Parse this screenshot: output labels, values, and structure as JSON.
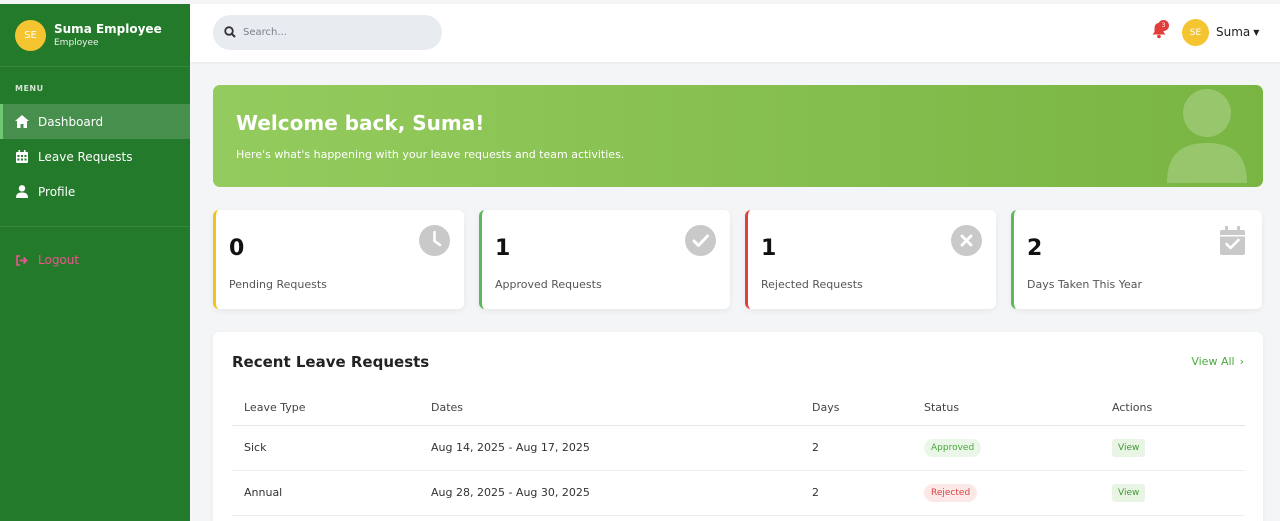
{
  "sidebar": {
    "user_initials": "SE",
    "user_name": "Suma Employee",
    "user_role": "Employee",
    "menu_heading": "MENU",
    "items": [
      {
        "label": "Dashboard",
        "icon": "home-icon",
        "active": true
      },
      {
        "label": "Leave Requests",
        "icon": "calendar-icon",
        "active": false
      },
      {
        "label": "Profile",
        "icon": "user-icon",
        "active": false
      }
    ],
    "logout_label": "Logout"
  },
  "topbar": {
    "search_placeholder": "Search...",
    "notification_count": "3",
    "user_initials": "SE",
    "user_name": "Suma"
  },
  "welcome": {
    "title": "Welcome back, Suma!",
    "subtitle": "Here's what's happening with your leave requests and team activities."
  },
  "stats": [
    {
      "value": "0",
      "label": "Pending Requests",
      "color": "#f2c31b",
      "icon": "clock-icon"
    },
    {
      "value": "1",
      "label": "Approved Requests",
      "color": "#5cb85c",
      "icon": "check-circle-icon"
    },
    {
      "value": "1",
      "label": "Rejected Requests",
      "color": "#e0413f",
      "icon": "x-circle-icon"
    },
    {
      "value": "2",
      "label": "Days Taken This Year",
      "color": "#5cb85c",
      "icon": "calendar-check-icon"
    }
  ],
  "recent": {
    "title": "Recent Leave Requests",
    "view_all": "View All",
    "columns": [
      "Leave Type",
      "Dates",
      "Days",
      "Status",
      "Actions"
    ],
    "rows": [
      {
        "type": "Sick",
        "dates": "Aug 14, 2025 - Aug 17, 2025",
        "days": "2",
        "status": "Approved",
        "action": "View"
      },
      {
        "type": "Annual",
        "dates": "Aug 28, 2025 - Aug 30, 2025",
        "days": "2",
        "status": "Rejected",
        "action": "View"
      }
    ]
  },
  "colors": {
    "sidebar": "#237a2a",
    "accent": "#4aaa3c",
    "avatar": "#f5c431"
  }
}
